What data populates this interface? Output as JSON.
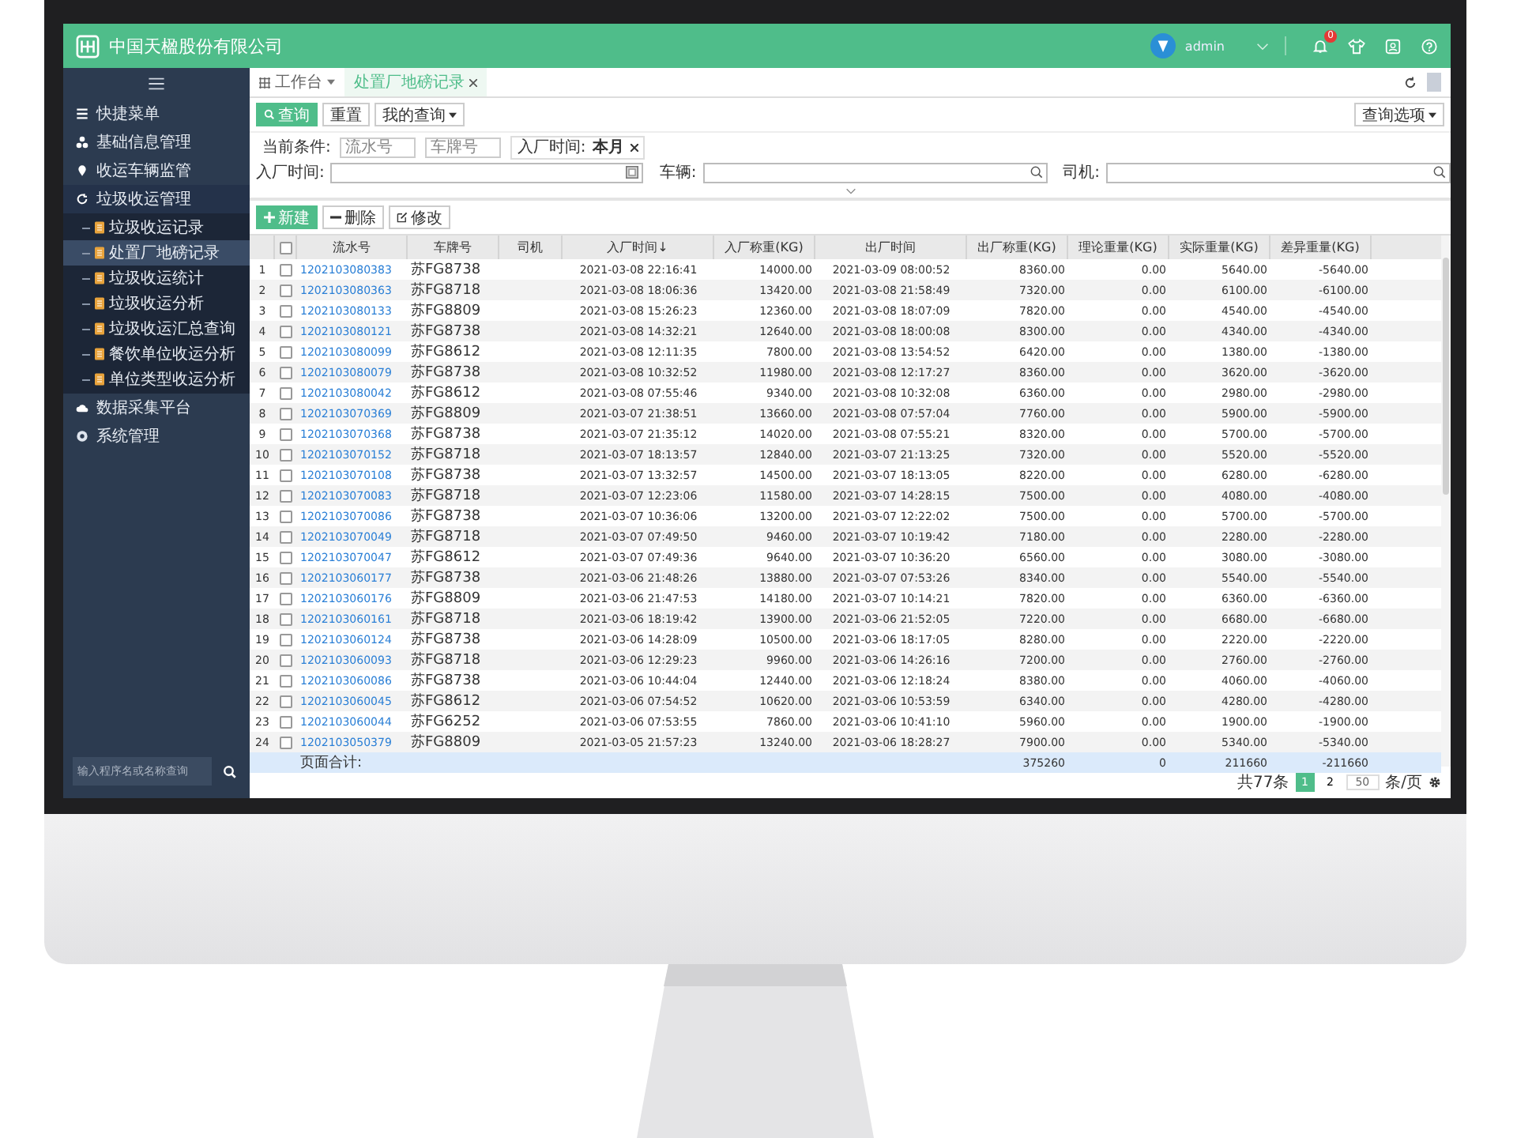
{
  "header": {
    "company": "中国天楹股份有限公司",
    "user": "admin",
    "notification_count": "0"
  },
  "sidebar": {
    "items": [
      {
        "label": "快捷菜单"
      },
      {
        "label": "基础信息管理"
      },
      {
        "label": "收运车辆监管"
      },
      {
        "label": "垃圾收运管理",
        "expanded": true,
        "children": [
          {
            "label": "垃圾收运记录",
            "selected": false
          },
          {
            "label": "处置厂地磅记录",
            "selected": true
          },
          {
            "label": "垃圾收运统计",
            "selected": false
          },
          {
            "label": "垃圾收运分析",
            "selected": false
          },
          {
            "label": "垃圾收运汇总查询",
            "selected": false
          },
          {
            "label": "餐饮单位收运分析",
            "selected": false
          },
          {
            "label": "单位类型收运分析",
            "selected": false
          }
        ]
      },
      {
        "label": "数据采集平台"
      },
      {
        "label": "系统管理"
      }
    ],
    "search": {
      "placeholder": "输入程序名或名称查询"
    }
  },
  "tabs": [
    {
      "label": "工作台",
      "selected": false,
      "kind": "menu"
    },
    {
      "label": "处置厂地磅记录",
      "selected": true,
      "kind": "closable"
    }
  ],
  "query_buttons": [
    {
      "label": "查询",
      "kind": "primary"
    },
    {
      "label": "重置",
      "kind": "plain"
    },
    {
      "label": "我的查询",
      "kind": "dropdown"
    }
  ],
  "query_options": "查询选项",
  "filters": {
    "label": "当前条件:",
    "fields": [
      {
        "placeholder": "流水号"
      },
      {
        "placeholder": "车牌号"
      }
    ],
    "tag": {
      "name": "入厂时间:",
      "value": "本月"
    }
  },
  "search_fields": [
    {
      "label": "入厂时间:",
      "kind": "date"
    },
    {
      "label": "车辆:",
      "kind": "search"
    },
    {
      "label": "司机:",
      "kind": "search"
    }
  ],
  "toolbar": [
    {
      "label": "新建",
      "kind": "add"
    },
    {
      "label": "删除",
      "kind": "remove"
    },
    {
      "label": "修改",
      "kind": "edit"
    }
  ],
  "table": {
    "all_checked": false,
    "columns": [
      {
        "label": "流水号"
      },
      {
        "label": "车牌号"
      },
      {
        "label": "司机"
      },
      {
        "label": "入厂时间↓"
      },
      {
        "label": "入厂称重(KG)"
      },
      {
        "label": "出厂时间"
      },
      {
        "label": "出厂称重(KG)"
      },
      {
        "label": "理论重量(KG)"
      },
      {
        "label": "实际重量(KG)"
      },
      {
        "label": "差异重量(KG)"
      }
    ],
    "rows": [
      {
        "no": "1",
        "checked": false,
        "serial": "1202103080383",
        "plate": "苏FG8738",
        "in_time": "2021-03-08 22:16:41",
        "in_weight": "14000.00",
        "out_time": "2021-03-09 08:00:52",
        "out_weight": "8360.00",
        "theory": "0.00",
        "actual": "5640.00",
        "diff": "-5640.00"
      },
      {
        "no": "2",
        "checked": false,
        "serial": "1202103080363",
        "plate": "苏FG8718",
        "in_time": "2021-03-08 18:06:36",
        "in_weight": "13420.00",
        "out_time": "2021-03-08 21:58:49",
        "out_weight": "7320.00",
        "theory": "0.00",
        "actual": "6100.00",
        "diff": "-6100.00"
      },
      {
        "no": "3",
        "checked": false,
        "serial": "1202103080133",
        "plate": "苏FG8809",
        "in_time": "2021-03-08 15:26:23",
        "in_weight": "12360.00",
        "out_time": "2021-03-08 18:07:09",
        "out_weight": "7820.00",
        "theory": "0.00",
        "actual": "4540.00",
        "diff": "-4540.00"
      },
      {
        "no": "4",
        "checked": false,
        "serial": "1202103080121",
        "plate": "苏FG8738",
        "in_time": "2021-03-08 14:32:21",
        "in_weight": "12640.00",
        "out_time": "2021-03-08 18:00:08",
        "out_weight": "8300.00",
        "theory": "0.00",
        "actual": "4340.00",
        "diff": "-4340.00"
      },
      {
        "no": "5",
        "checked": false,
        "serial": "1202103080099",
        "plate": "苏FG8612",
        "in_time": "2021-03-08 12:11:35",
        "in_weight": "7800.00",
        "out_time": "2021-03-08 13:54:52",
        "out_weight": "6420.00",
        "theory": "0.00",
        "actual": "1380.00",
        "diff": "-1380.00"
      },
      {
        "no": "6",
        "checked": false,
        "serial": "1202103080079",
        "plate": "苏FG8738",
        "in_time": "2021-03-08 10:32:52",
        "in_weight": "11980.00",
        "out_time": "2021-03-08 12:17:27",
        "out_weight": "8360.00",
        "theory": "0.00",
        "actual": "3620.00",
        "diff": "-3620.00"
      },
      {
        "no": "7",
        "checked": false,
        "serial": "1202103080042",
        "plate": "苏FG8612",
        "in_time": "2021-03-08 07:55:46",
        "in_weight": "9340.00",
        "out_time": "2021-03-08 10:32:08",
        "out_weight": "6360.00",
        "theory": "0.00",
        "actual": "2980.00",
        "diff": "-2980.00"
      },
      {
        "no": "8",
        "checked": false,
        "serial": "1202103070369",
        "plate": "苏FG8809",
        "in_time": "2021-03-07 21:38:51",
        "in_weight": "13660.00",
        "out_time": "2021-03-08 07:57:04",
        "out_weight": "7760.00",
        "theory": "0.00",
        "actual": "5900.00",
        "diff": "-5900.00"
      },
      {
        "no": "9",
        "checked": false,
        "serial": "1202103070368",
        "plate": "苏FG8738",
        "in_time": "2021-03-07 21:35:12",
        "in_weight": "14020.00",
        "out_time": "2021-03-08 07:55:21",
        "out_weight": "8320.00",
        "theory": "0.00",
        "actual": "5700.00",
        "diff": "-5700.00"
      },
      {
        "no": "10",
        "checked": false,
        "serial": "1202103070152",
        "plate": "苏FG8718",
        "in_time": "2021-03-07 18:13:57",
        "in_weight": "12840.00",
        "out_time": "2021-03-07 21:13:25",
        "out_weight": "7320.00",
        "theory": "0.00",
        "actual": "5520.00",
        "diff": "-5520.00"
      },
      {
        "no": "11",
        "checked": false,
        "serial": "1202103070108",
        "plate": "苏FG8738",
        "in_time": "2021-03-07 13:32:57",
        "in_weight": "14500.00",
        "out_time": "2021-03-07 18:13:05",
        "out_weight": "8220.00",
        "theory": "0.00",
        "actual": "6280.00",
        "diff": "-6280.00"
      },
      {
        "no": "12",
        "checked": false,
        "serial": "1202103070083",
        "plate": "苏FG8718",
        "in_time": "2021-03-07 12:23:06",
        "in_weight": "11580.00",
        "out_time": "2021-03-07 14:28:15",
        "out_weight": "7500.00",
        "theory": "0.00",
        "actual": "4080.00",
        "diff": "-4080.00"
      },
      {
        "no": "13",
        "checked": false,
        "serial": "1202103070086",
        "plate": "苏FG8738",
        "in_time": "2021-03-07 10:36:06",
        "in_weight": "13200.00",
        "out_time": "2021-03-07 12:22:02",
        "out_weight": "7500.00",
        "theory": "0.00",
        "actual": "5700.00",
        "diff": "-5700.00"
      },
      {
        "no": "14",
        "checked": false,
        "serial": "1202103070049",
        "plate": "苏FG8718",
        "in_time": "2021-03-07 07:49:50",
        "in_weight": "9460.00",
        "out_time": "2021-03-07 10:19:42",
        "out_weight": "7180.00",
        "theory": "0.00",
        "actual": "2280.00",
        "diff": "-2280.00"
      },
      {
        "no": "15",
        "checked": false,
        "serial": "1202103070047",
        "plate": "苏FG8612",
        "in_time": "2021-03-07 07:49:36",
        "in_weight": "9640.00",
        "out_time": "2021-03-07 10:36:20",
        "out_weight": "6560.00",
        "theory": "0.00",
        "actual": "3080.00",
        "diff": "-3080.00"
      },
      {
        "no": "16",
        "checked": false,
        "serial": "1202103060177",
        "plate": "苏FG8738",
        "in_time": "2021-03-06 21:48:26",
        "in_weight": "13880.00",
        "out_time": "2021-03-07 07:53:26",
        "out_weight": "8340.00",
        "theory": "0.00",
        "actual": "5540.00",
        "diff": "-5540.00"
      },
      {
        "no": "17",
        "checked": false,
        "serial": "1202103060176",
        "plate": "苏FG8809",
        "in_time": "2021-03-06 21:47:53",
        "in_weight": "14180.00",
        "out_time": "2021-03-07 10:14:21",
        "out_weight": "7820.00",
        "theory": "0.00",
        "actual": "6360.00",
        "diff": "-6360.00"
      },
      {
        "no": "18",
        "checked": false,
        "serial": "1202103060161",
        "plate": "苏FG8718",
        "in_time": "2021-03-06 18:19:42",
        "in_weight": "13900.00",
        "out_time": "2021-03-06 21:52:05",
        "out_weight": "7220.00",
        "theory": "0.00",
        "actual": "6680.00",
        "diff": "-6680.00"
      },
      {
        "no": "19",
        "checked": false,
        "serial": "1202103060124",
        "plate": "苏FG8738",
        "in_time": "2021-03-06 14:28:09",
        "in_weight": "10500.00",
        "out_time": "2021-03-06 18:17:05",
        "out_weight": "8280.00",
        "theory": "0.00",
        "actual": "2220.00",
        "diff": "-2220.00"
      },
      {
        "no": "20",
        "checked": false,
        "serial": "1202103060093",
        "plate": "苏FG8718",
        "in_time": "2021-03-06 12:29:23",
        "in_weight": "9960.00",
        "out_time": "2021-03-06 14:26:16",
        "out_weight": "7200.00",
        "theory": "0.00",
        "actual": "2760.00",
        "diff": "-2760.00"
      },
      {
        "no": "21",
        "checked": false,
        "serial": "1202103060086",
        "plate": "苏FG8738",
        "in_time": "2021-03-06 10:44:04",
        "in_weight": "12440.00",
        "out_time": "2021-03-06 12:18:24",
        "out_weight": "8380.00",
        "theory": "0.00",
        "actual": "4060.00",
        "diff": "-4060.00"
      },
      {
        "no": "22",
        "checked": false,
        "serial": "1202103060045",
        "plate": "苏FG8612",
        "in_time": "2021-03-06 07:54:52",
        "in_weight": "10620.00",
        "out_time": "2021-03-06 10:53:59",
        "out_weight": "6340.00",
        "theory": "0.00",
        "actual": "4280.00",
        "diff": "-4280.00"
      },
      {
        "no": "23",
        "checked": false,
        "serial": "1202103060044",
        "plate": "苏FG6252",
        "in_time": "2021-03-06 07:53:55",
        "in_weight": "7860.00",
        "out_time": "2021-03-06 10:41:10",
        "out_weight": "5960.00",
        "theory": "0.00",
        "actual": "1900.00",
        "diff": "-1900.00"
      },
      {
        "no": "24",
        "checked": false,
        "serial": "1202103050379",
        "plate": "苏FG8809",
        "in_time": "2021-03-05 21:57:23",
        "in_weight": "13240.00",
        "out_time": "2021-03-06 18:28:27",
        "out_weight": "7900.00",
        "theory": "0.00",
        "actual": "5340.00",
        "diff": "-5340.00"
      }
    ],
    "footer": {
      "label": "页面合计:",
      "out_weight": "375260",
      "theory": "0",
      "actual": "211660",
      "diff": "-211660"
    }
  },
  "pagination": {
    "total": "共77条",
    "pages": [
      {
        "label": "1",
        "selected": true
      },
      {
        "label": "2",
        "selected": false
      }
    ],
    "page_size": "50",
    "per_page": "条/页"
  }
}
